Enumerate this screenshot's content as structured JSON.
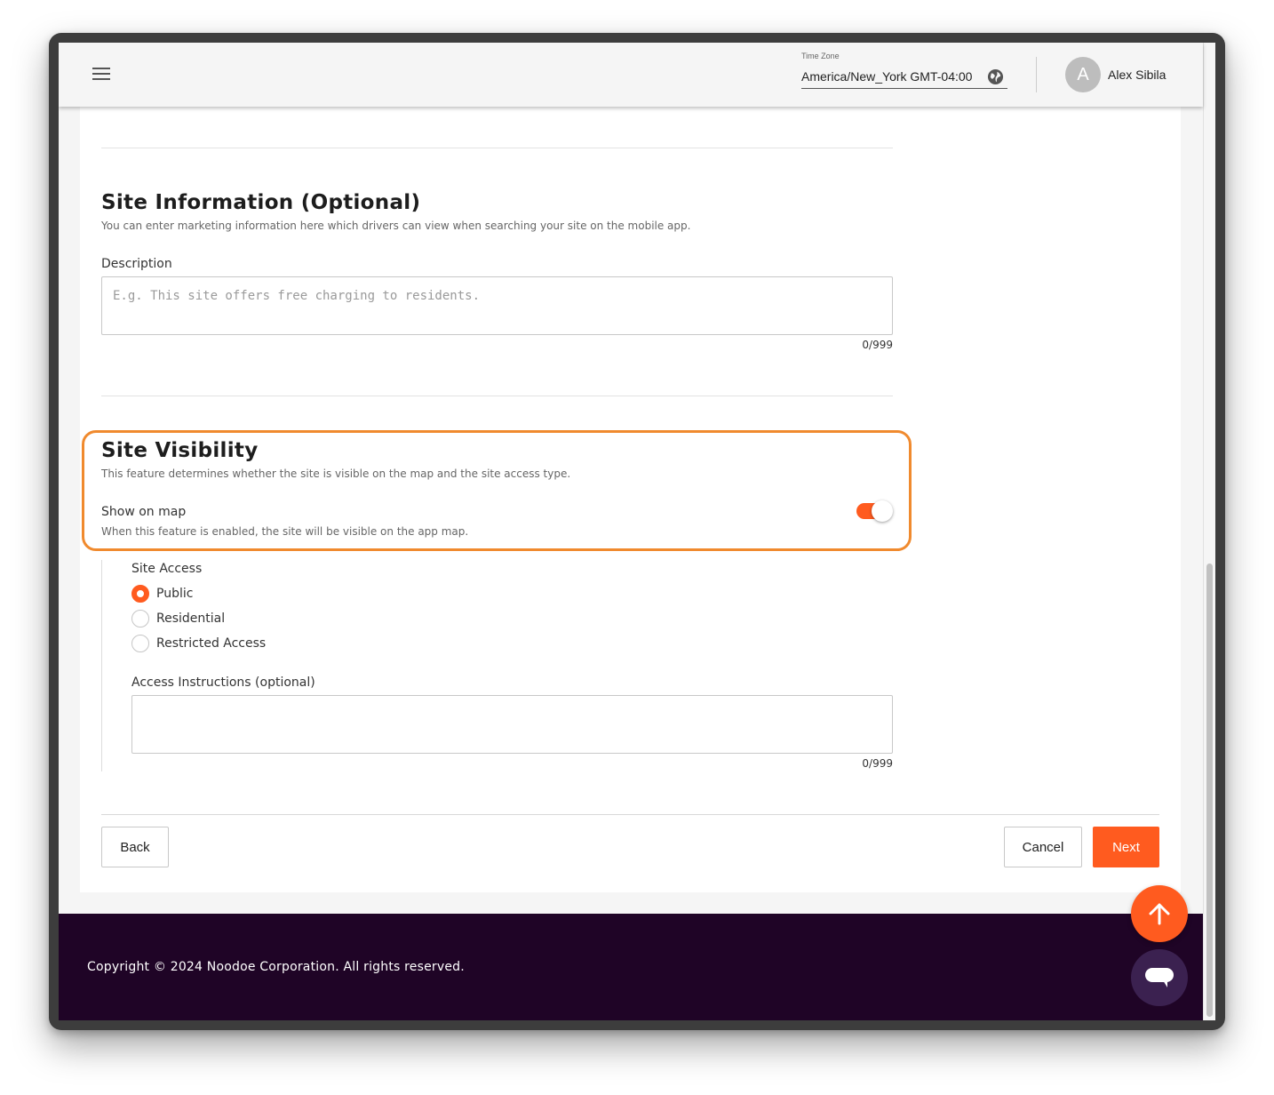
{
  "header": {
    "menu_icon": "hamburger-menu-icon",
    "timezone_label": "Time Zone",
    "timezone_value": "America/New_York GMT-04:00",
    "timezone_icon": "globe-icon",
    "avatar_initial": "A",
    "user_name": "Alex Sibila"
  },
  "site_information": {
    "title": "Site Information (Optional)",
    "description": "You can enter marketing information here which drivers can view when searching your site on the mobile app.",
    "description_field": {
      "label": "Description",
      "value": "",
      "placeholder": "E.g. This site offers free charging to residents.",
      "counter": "0/999"
    }
  },
  "site_visibility": {
    "title": "Site Visibility",
    "description": "This feature determines whether the site is visible on the map and the site access type.",
    "show_on_map": {
      "label": "Show on map",
      "hint": "When this feature is enabled, the site will be visible on the app map.",
      "enabled": true
    },
    "site_access": {
      "label": "Site Access",
      "selected": "Public",
      "options": [
        "Public",
        "Residential",
        "Restricted Access"
      ]
    },
    "access_instructions": {
      "label": "Access Instructions (optional)",
      "value": "",
      "counter": "0/999"
    }
  },
  "actions": {
    "back_label": "Back",
    "cancel_label": "Cancel",
    "next_label": "Next"
  },
  "footer": {
    "copyright": "Copyright © 2024 Noodoe Corporation. All rights reserved."
  },
  "floating": {
    "scroll_top_icon": "arrow-up-icon",
    "chat_icon": "chat-bubble-icon"
  },
  "colors": {
    "accent": "#ff5b1f",
    "highlight_border": "#f08a2e",
    "footer_bg": "#1f0426",
    "chat_bg": "#3b2150"
  }
}
